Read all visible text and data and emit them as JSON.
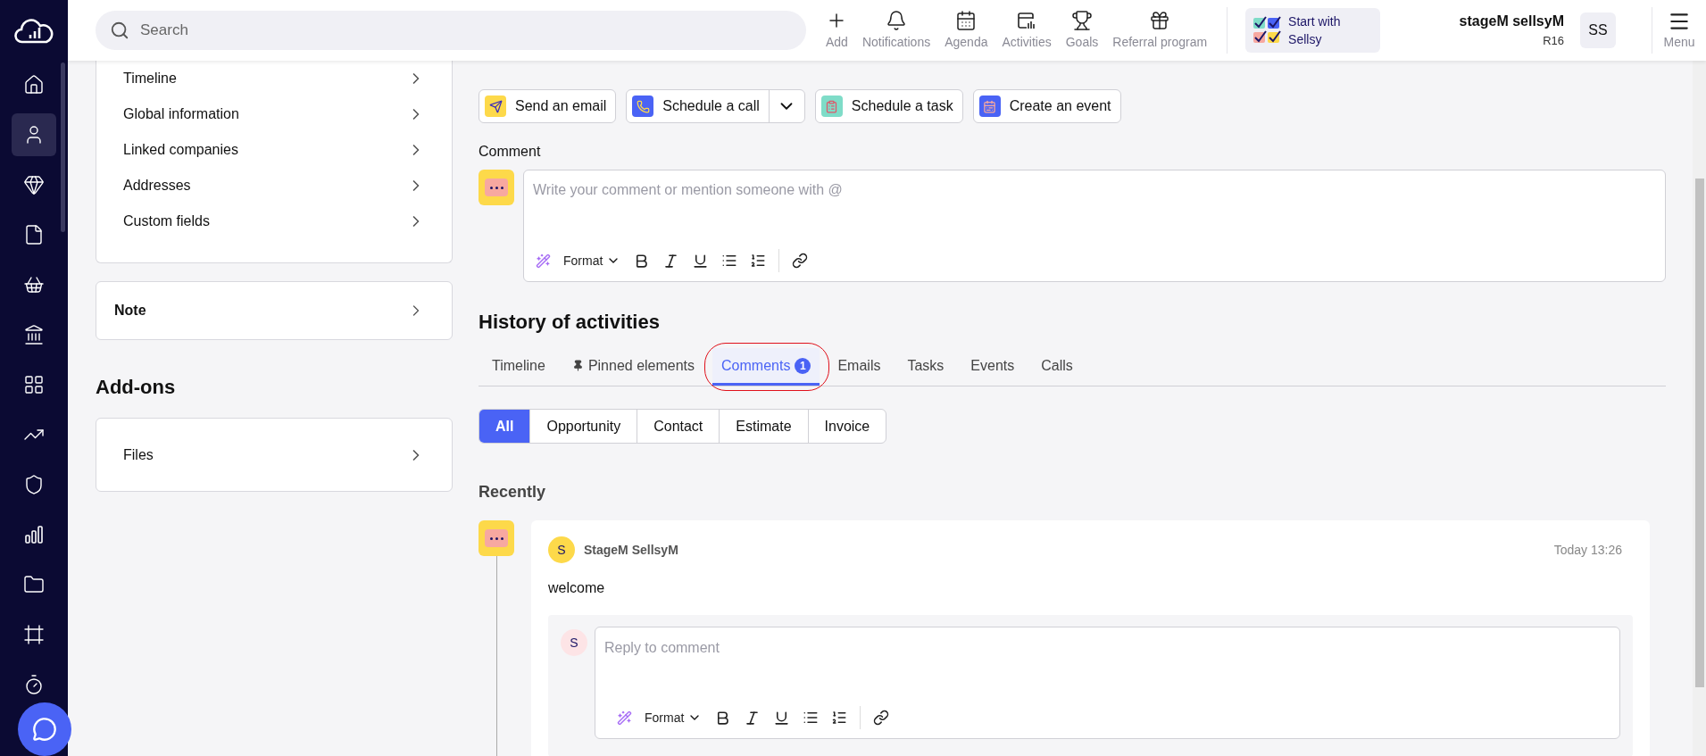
{
  "search": {
    "placeholder": "Search"
  },
  "top_actions": [
    {
      "label": "Add"
    },
    {
      "label": "Notifications"
    },
    {
      "label": "Agenda"
    },
    {
      "label": "Activities"
    },
    {
      "label": "Goals"
    },
    {
      "label": "Referral program"
    }
  ],
  "promo": {
    "label": "Start with Sellsy"
  },
  "user": {
    "name": "stageM sellsyM",
    "role": "R16",
    "initials": "SS"
  },
  "menu": {
    "label": "Menu"
  },
  "nav": [
    {
      "selected": false
    },
    {
      "selected": true
    },
    {
      "selected": false
    },
    {
      "selected": false
    },
    {
      "selected": false
    },
    {
      "selected": false
    },
    {
      "selected": false
    },
    {
      "selected": false
    },
    {
      "selected": false
    },
    {
      "selected": false
    },
    {
      "selected": false
    },
    {
      "selected": false
    },
    {
      "selected": false
    }
  ],
  "sections": [
    {
      "label": "Timeline"
    },
    {
      "label": "Global information"
    },
    {
      "label": "Linked companies"
    },
    {
      "label": "Addresses"
    },
    {
      "label": "Custom fields"
    }
  ],
  "note": {
    "label": "Note"
  },
  "addons": {
    "title": "Add-ons",
    "items": [
      {
        "label": "Files"
      }
    ]
  },
  "activity_buttons": [
    {
      "label": "Send an email",
      "dropdown": false
    },
    {
      "label": "Schedule a call",
      "dropdown": true
    },
    {
      "label": "Schedule a task",
      "dropdown": false
    },
    {
      "label": "Create an event",
      "dropdown": false
    }
  ],
  "comment": {
    "label": "Comment",
    "placeholder": "Write your comment or mention someone with @",
    "format_label": "Format"
  },
  "history": {
    "title": "History of activities",
    "tabs": [
      {
        "label": "Timeline",
        "selected": false,
        "pinned": false,
        "highlighted": false
      },
      {
        "label": "Pinned elements",
        "selected": false,
        "pinned": true,
        "highlighted": false
      },
      {
        "label": "Comments",
        "selected": true,
        "pinned": false,
        "highlighted": true,
        "count": "1"
      },
      {
        "label": "Emails",
        "selected": false,
        "pinned": false,
        "highlighted": false
      },
      {
        "label": "Tasks",
        "selected": false,
        "pinned": false,
        "highlighted": false
      },
      {
        "label": "Events",
        "selected": false,
        "pinned": false,
        "highlighted": false
      },
      {
        "label": "Calls",
        "selected": false,
        "pinned": false,
        "highlighted": false
      }
    ],
    "filters": [
      {
        "label": "All",
        "selected": true
      },
      {
        "label": "Opportunity",
        "selected": false
      },
      {
        "label": "Contact",
        "selected": false
      },
      {
        "label": "Estimate",
        "selected": false
      },
      {
        "label": "Invoice",
        "selected": false
      }
    ],
    "group": "Recently",
    "entries": [
      {
        "author": "StageM SellsyM",
        "initial": "S",
        "time": "Today 13:26",
        "text": "welcome",
        "reply": {
          "initial": "S",
          "placeholder": "Reply to comment",
          "format_label": "Format"
        }
      }
    ]
  }
}
